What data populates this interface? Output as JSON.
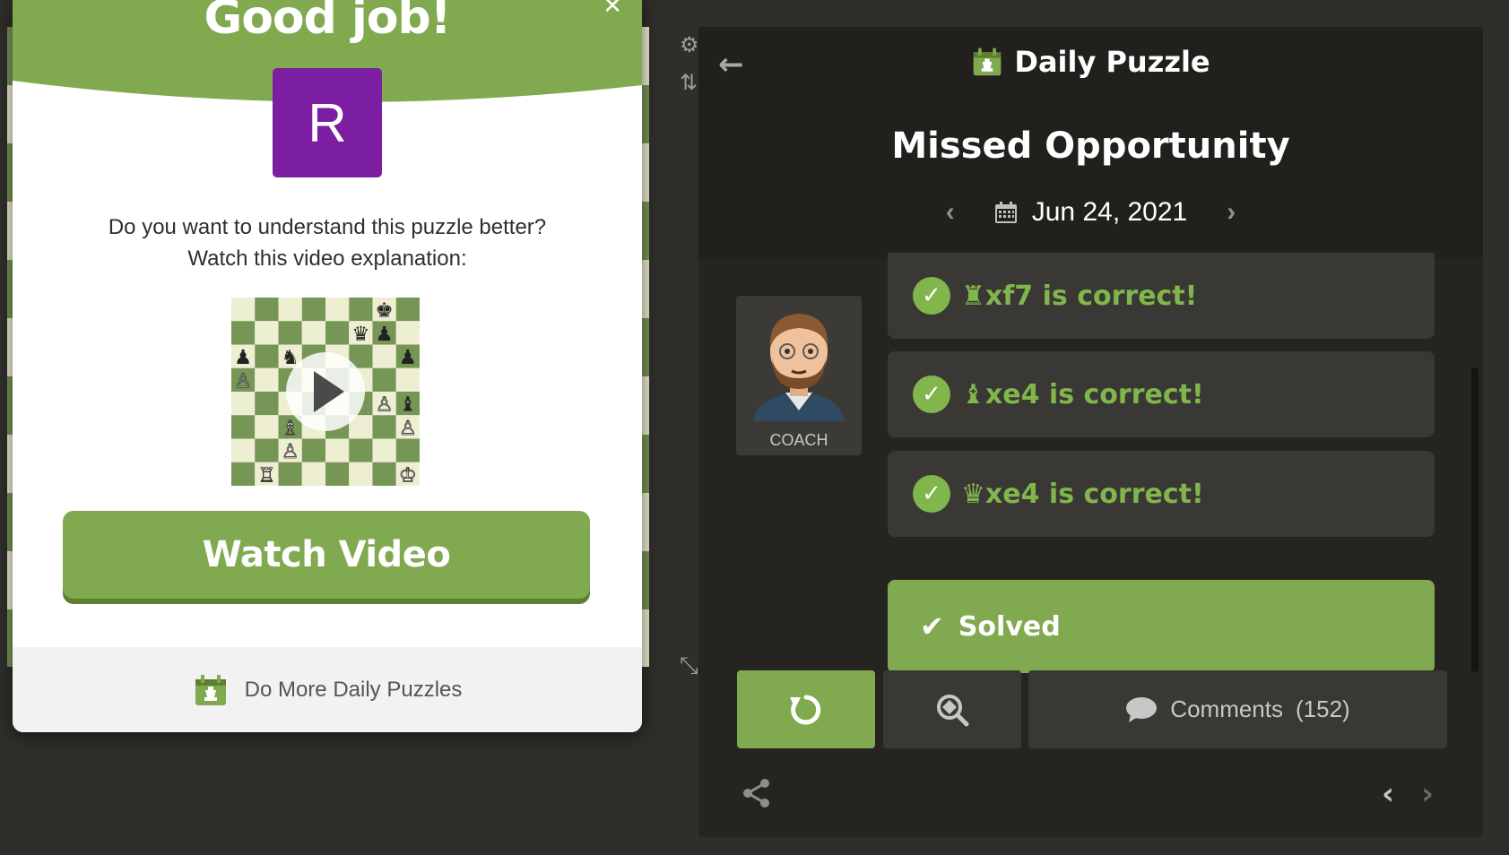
{
  "modal": {
    "title": "Good job!",
    "close_icon": "close-icon",
    "avatar_letter": "R",
    "prompt_line1": "Do you want to understand this puzzle better?",
    "prompt_line2": "Watch this video explanation:",
    "watch_label": "Watch Video",
    "footer_label": "Do More Daily Puzzles"
  },
  "panel": {
    "header_title": "Daily Puzzle",
    "puzzle_name": "Missed Opportunity",
    "date": "Jun 24, 2021",
    "coach_label": "COACH",
    "moves": [
      {
        "piece": "♜",
        "text": "xf7 is correct!"
      },
      {
        "piece": "♝",
        "text": "xe4 is correct!"
      },
      {
        "piece": "♛",
        "text": "xe4 is correct!"
      }
    ],
    "solved_label": "Solved",
    "comments_label": "Comments",
    "comments_count": "(152)"
  },
  "colors": {
    "accent_green": "#81a94f",
    "correct_green": "#81b64c",
    "avatar_purple": "#7b1ea2",
    "panel_bg": "#262421",
    "page_bg": "#302e2b"
  }
}
